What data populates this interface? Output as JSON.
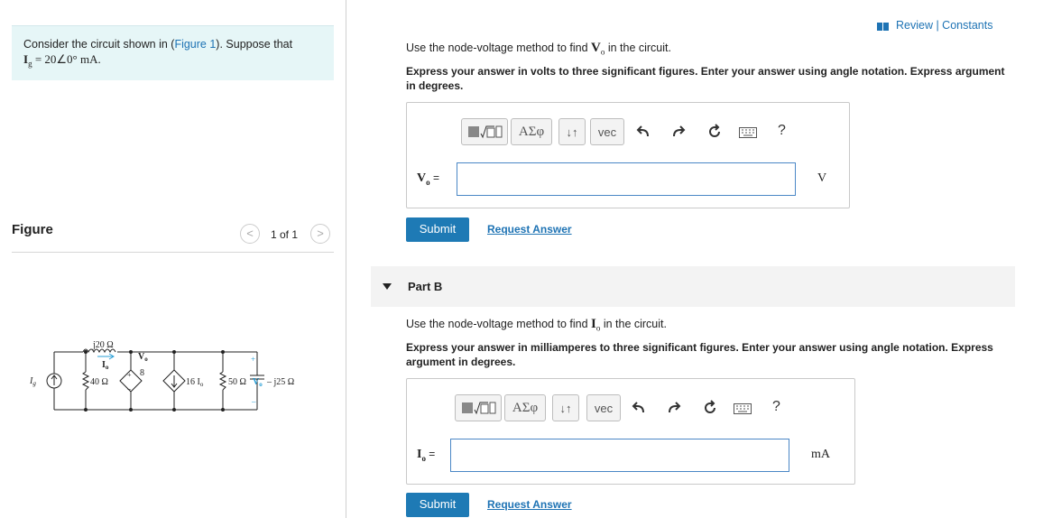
{
  "left": {
    "problem_prefix": "Consider the circuit shown in (",
    "figure_link": "Figure 1",
    "problem_suffix": "). Suppose that",
    "problem_eq": "I",
    "problem_eq_sub": "g",
    "problem_eq_rest": " = 20∠0° mA.",
    "figure_heading": "Figure",
    "pager_text": "1 of 1",
    "pager_prev": "<",
    "pager_next": ">"
  },
  "circuit": {
    "j20": "j20 Ω",
    "r40": "40 Ω",
    "Ig": "I",
    "Ig_sub": "g",
    "Io": "I",
    "Io_sub": "o",
    "Vo8_num": "V",
    "Vo8_sub": "o",
    "Vo8_den": "8",
    "plus": "+",
    "minus": "–",
    "dep16": "16 I",
    "dep16_sub": "o",
    "r50": "50 Ω",
    "Vo": "V",
    "Vo_sub": "o",
    "cap": "– j25 Ω"
  },
  "header": {
    "review_link": "Review | Constants"
  },
  "partA": {
    "instruction_pre": "Use the node-voltage method to find ",
    "instruction_var": "V",
    "instruction_sub": "o",
    "instruction_post": " in the circuit.",
    "instruction_bold": "Express your answer in volts to three significant figures. Enter your answer using angle notation. Express argument in degrees.",
    "label": "V",
    "label_sub": "o",
    "label_eq": " =",
    "input_value": "",
    "unit": "V",
    "submit": "Submit",
    "request": "Request Answer"
  },
  "partB": {
    "title": "Part B",
    "instruction_pre": "Use the node-voltage method to find ",
    "instruction_var": "I",
    "instruction_sub": "o",
    "instruction_post": " in the circuit.",
    "instruction_bold": "Express your answer in milliamperes to three significant figures. Enter your answer using angle notation. Express argument in degrees.",
    "label": "I",
    "label_sub": "o",
    "label_eq": " =",
    "input_value": "",
    "unit": "mA",
    "submit": "Submit",
    "request": "Request Answer"
  },
  "toolbar": {
    "greek": "ΑΣφ",
    "arrows": "↓↑",
    "vec": "vec",
    "help": "?"
  },
  "colors": {
    "accent": "#1e7ab5",
    "problem_bg": "#e6f6f7",
    "link": "#1e73b4"
  }
}
